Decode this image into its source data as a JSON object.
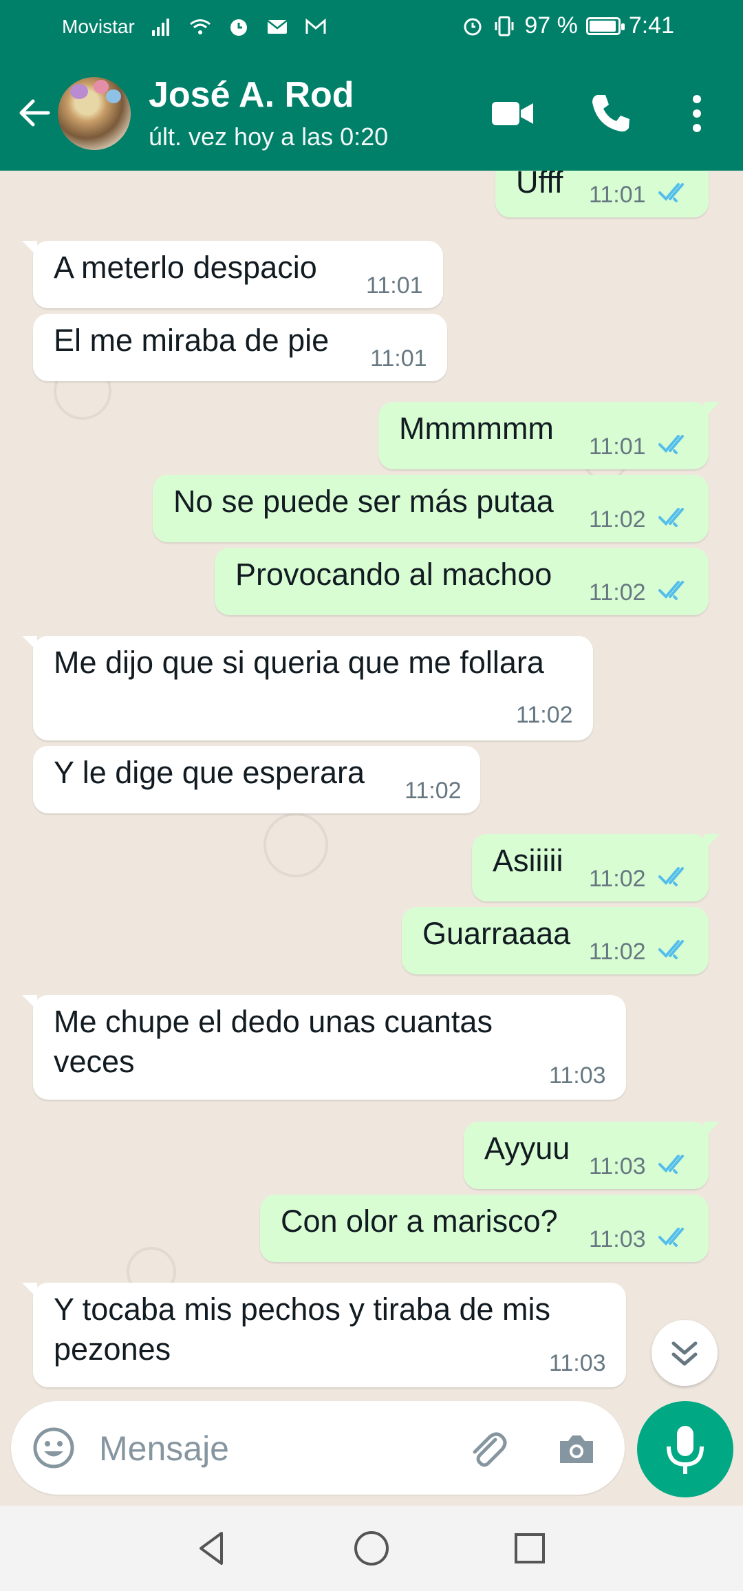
{
  "status_bar": {
    "carrier": "Movistar",
    "battery": "97 %",
    "battery_level": 0.97,
    "time": "7:41"
  },
  "header": {
    "contact_name": "José A. Rod",
    "last_seen": "últ. vez hoy a las 0:20",
    "icons": [
      "back-arrow-icon",
      "avatar",
      "video-call-icon",
      "phone-icon",
      "more-options-icon"
    ]
  },
  "messages": [
    {
      "dir": "out",
      "text": "Ufff",
      "time": "11:01",
      "status": "read"
    },
    {
      "dir": "in",
      "text": "A meterlo despacio",
      "time": "11:01"
    },
    {
      "dir": "in",
      "text": "El me miraba de pie",
      "time": "11:01"
    },
    {
      "dir": "out",
      "text": "Mmmmmm",
      "time": "11:01",
      "status": "read"
    },
    {
      "dir": "out",
      "text": "No se puede ser más putaa",
      "time": "11:02",
      "status": "read"
    },
    {
      "dir": "out",
      "text": "Provocando al machoo",
      "time": "11:02",
      "status": "read"
    },
    {
      "dir": "in",
      "text": "Me dijo que si queria que me follara",
      "time": "11:02"
    },
    {
      "dir": "in",
      "text": "Y le dige que esperara",
      "time": "11:02"
    },
    {
      "dir": "out",
      "text": "Asiiiii",
      "time": "11:02",
      "status": "read"
    },
    {
      "dir": "out",
      "text": "Guarraaaa",
      "time": "11:02",
      "status": "read"
    },
    {
      "dir": "in",
      "text": "Me chupe el dedo unas cuantas\nveces",
      "time": "11:03"
    },
    {
      "dir": "out",
      "text": "Ayyuu",
      "time": "11:03",
      "status": "read"
    },
    {
      "dir": "out",
      "text": "Con olor a marisco?",
      "time": "11:03",
      "status": "read"
    },
    {
      "dir": "in",
      "text": "Y tocaba mis pechos y tiraba de mis\npezones",
      "time": "11:03"
    }
  ],
  "composer": {
    "placeholder": "Mensaje",
    "icons": [
      "emoji-icon",
      "attach-icon",
      "camera-icon",
      "mic-icon"
    ]
  },
  "colors": {
    "header": "#008069",
    "outgoing_bubble": "#D9FDD3",
    "incoming_bubble": "#FFFFFF",
    "read_ticks": "#53BDEB",
    "mic_button": "#00A884"
  }
}
